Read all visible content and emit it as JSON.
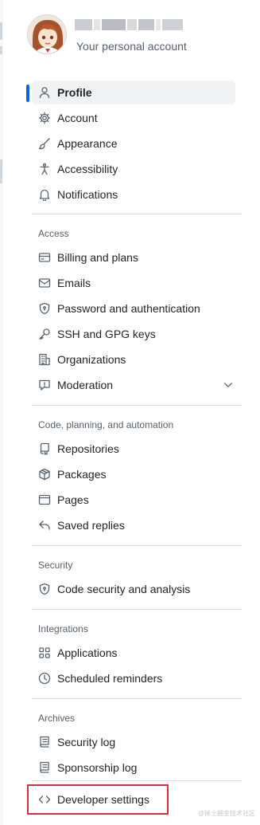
{
  "account": {
    "subtitle": "Your personal account"
  },
  "nav": {
    "items": [
      {
        "label": "Profile",
        "icon": "person-icon",
        "active": true
      },
      {
        "label": "Account",
        "icon": "gear-icon"
      },
      {
        "label": "Appearance",
        "icon": "paintbrush-icon"
      },
      {
        "label": "Accessibility",
        "icon": "accessibility-icon"
      },
      {
        "label": "Notifications",
        "icon": "bell-icon"
      }
    ],
    "sections": [
      {
        "title": "Access",
        "items": [
          {
            "label": "Billing and plans",
            "icon": "credit-card-icon"
          },
          {
            "label": "Emails",
            "icon": "mail-icon"
          },
          {
            "label": "Password and authentication",
            "icon": "shield-lock-icon"
          },
          {
            "label": "SSH and GPG keys",
            "icon": "key-icon"
          },
          {
            "label": "Organizations",
            "icon": "organization-icon"
          },
          {
            "label": "Moderation",
            "icon": "report-icon",
            "expandable": true
          }
        ]
      },
      {
        "title": "Code, planning, and automation",
        "items": [
          {
            "label": "Repositories",
            "icon": "repo-icon"
          },
          {
            "label": "Packages",
            "icon": "package-icon"
          },
          {
            "label": "Pages",
            "icon": "browser-icon"
          },
          {
            "label": "Saved replies",
            "icon": "reply-icon"
          }
        ]
      },
      {
        "title": "Security",
        "items": [
          {
            "label": "Code security and analysis",
            "icon": "shield-lock-icon"
          }
        ]
      },
      {
        "title": "Integrations",
        "items": [
          {
            "label": "Applications",
            "icon": "apps-icon"
          },
          {
            "label": "Scheduled reminders",
            "icon": "clock-icon"
          }
        ]
      },
      {
        "title": "Archives",
        "items": [
          {
            "label": "Security log",
            "icon": "log-icon"
          },
          {
            "label": "Sponsorship log",
            "icon": "log-icon"
          }
        ]
      }
    ],
    "developer": {
      "label": "Developer settings",
      "icon": "code-icon"
    }
  },
  "colors": {
    "accent": "#0969da",
    "highlight_frame": "#d3303a",
    "text": "#1f2328",
    "muted": "#57606a"
  },
  "watermark": "@稀土掘金技术社区"
}
